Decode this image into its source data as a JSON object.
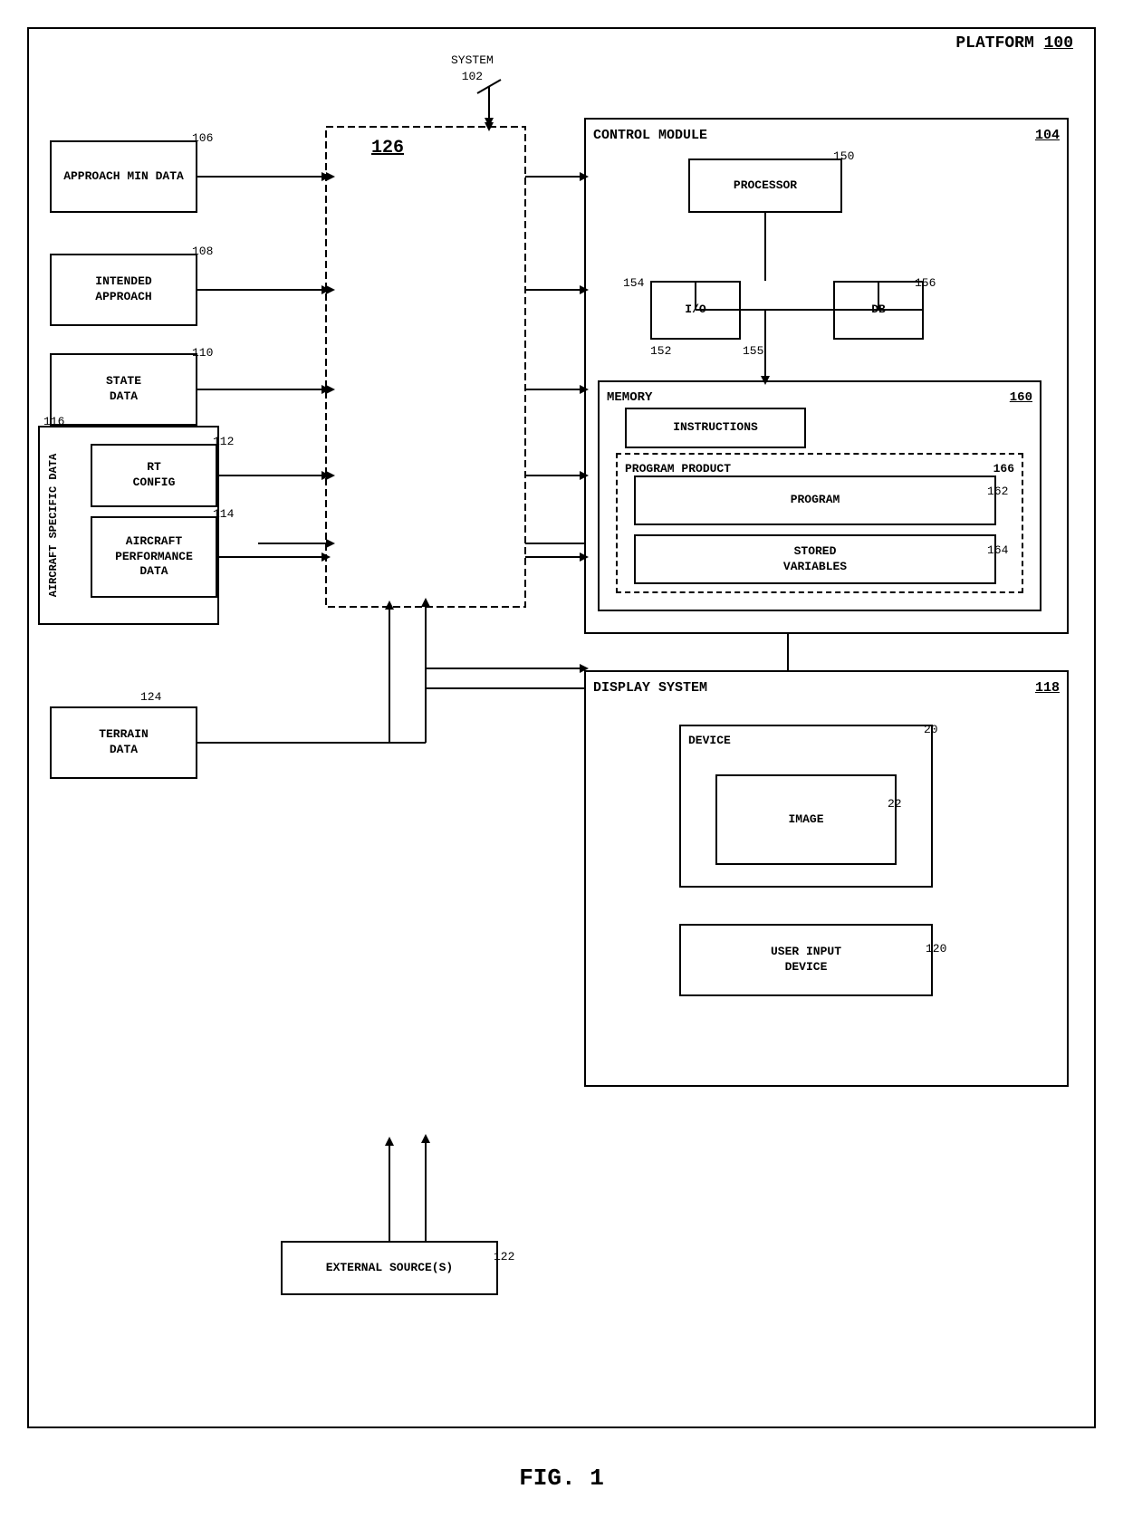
{
  "page": {
    "title": "FIG. 1",
    "platform_label": "PLATFORM",
    "platform_ref": "100",
    "system_label": "SYSTEM",
    "system_ref": "102"
  },
  "boxes": {
    "approach_min_data": {
      "label": "APPROACH\nMIN DATA",
      "ref": "106"
    },
    "intended_approach": {
      "label": "INTENDED\nAPPROACH",
      "ref": "108"
    },
    "state_data": {
      "label": "STATE\nDATA",
      "ref": "110"
    },
    "aircraft_specific_data": {
      "label": "AIRCRAFT SPECIFIC DATA",
      "ref": "116"
    },
    "rt_config": {
      "label": "RT\nCONFIG",
      "ref": "112"
    },
    "aircraft_performance_data": {
      "label": "AIRCRAFT\nPERFORMANCE\nDATA",
      "ref": "114"
    },
    "terrain_data": {
      "label": "TERRAIN\nDATA",
      "ref": "124"
    },
    "system_126": {
      "label": "126",
      "ref": ""
    },
    "control_module": {
      "label": "CONTROL MODULE",
      "ref": "104"
    },
    "processor": {
      "label": "PROCESSOR",
      "ref": "150"
    },
    "io": {
      "label": "I/O",
      "ref": "154"
    },
    "db": {
      "label": "DB",
      "ref": "156"
    },
    "memory": {
      "label": "MEMORY",
      "ref": "160"
    },
    "instructions": {
      "label": "INSTRUCTIONS",
      "ref": ""
    },
    "program_product": {
      "label": "PROGRAM PRODUCT",
      "ref": "166"
    },
    "program": {
      "label": "PROGRAM",
      "ref": "162"
    },
    "stored_variables": {
      "label": "STORED\nVARIABLES",
      "ref": "164"
    },
    "display_system": {
      "label": "DISPLAY SYSTEM",
      "ref": "118"
    },
    "device": {
      "label": "DEVICE",
      "ref": "20"
    },
    "image": {
      "label": "IMAGE",
      "ref": "22"
    },
    "user_input_device": {
      "label": "USER INPUT\nDEVICE",
      "ref": "120"
    },
    "external_sources": {
      "label": "EXTERNAL SOURCE(S)",
      "ref": "122"
    }
  },
  "fig_label": "FIG. 1"
}
